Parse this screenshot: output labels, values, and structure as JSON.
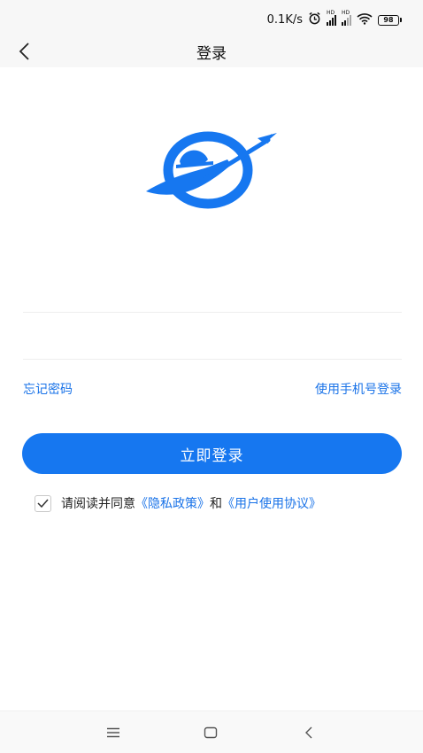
{
  "status_bar": {
    "speed": "0.1K/s",
    "signal_1_badge": "HD",
    "signal_2_badge": "HD",
    "battery_level": "98",
    "icons": [
      "alarm-icon",
      "signal-icon",
      "signal-icon",
      "wifi-icon",
      "battery-icon"
    ]
  },
  "header": {
    "back_icon": "back-arrow-icon",
    "title": "登录"
  },
  "logo": {
    "icon": "app-logo",
    "color": "#1677f0"
  },
  "form": {
    "account": {
      "value": "",
      "placeholder": ""
    },
    "password": {
      "value": "",
      "placeholder": ""
    }
  },
  "links": {
    "forgot_password": "忘记密码",
    "phone_login": "使用手机号登录"
  },
  "login_button": {
    "label": "立即登录",
    "color": "#1677f0"
  },
  "agreement": {
    "checked": true,
    "prefix": "请阅读并同意",
    "privacy_link": "《隐私政策》",
    "conjunction": "和",
    "terms_link": "《用户使用协议》"
  },
  "system_nav": {
    "icons": [
      "menu-icon",
      "home-icon",
      "back-icon"
    ]
  },
  "colors": {
    "accent": "#1677f0",
    "link": "#1a73e8",
    "bar_bg": "#f7f7f7"
  }
}
